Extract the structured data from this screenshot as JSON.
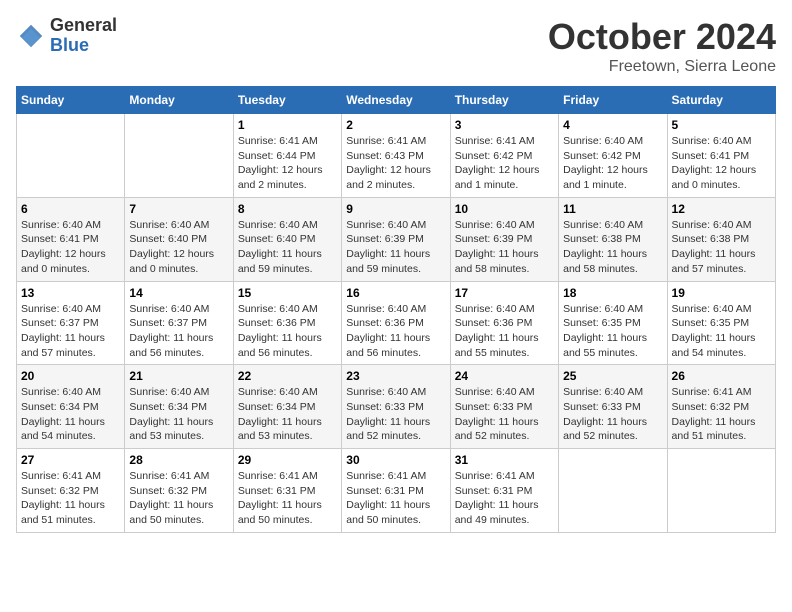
{
  "logo": {
    "general": "General",
    "blue": "Blue"
  },
  "title": "October 2024",
  "location": "Freetown, Sierra Leone",
  "days_header": [
    "Sunday",
    "Monday",
    "Tuesday",
    "Wednesday",
    "Thursday",
    "Friday",
    "Saturday"
  ],
  "weeks": [
    [
      {
        "day": "",
        "detail": ""
      },
      {
        "day": "",
        "detail": ""
      },
      {
        "day": "1",
        "detail": "Sunrise: 6:41 AM\nSunset: 6:44 PM\nDaylight: 12 hours\nand 2 minutes."
      },
      {
        "day": "2",
        "detail": "Sunrise: 6:41 AM\nSunset: 6:43 PM\nDaylight: 12 hours\nand 2 minutes."
      },
      {
        "day": "3",
        "detail": "Sunrise: 6:41 AM\nSunset: 6:42 PM\nDaylight: 12 hours\nand 1 minute."
      },
      {
        "day": "4",
        "detail": "Sunrise: 6:40 AM\nSunset: 6:42 PM\nDaylight: 12 hours\nand 1 minute."
      },
      {
        "day": "5",
        "detail": "Sunrise: 6:40 AM\nSunset: 6:41 PM\nDaylight: 12 hours\nand 0 minutes."
      }
    ],
    [
      {
        "day": "6",
        "detail": "Sunrise: 6:40 AM\nSunset: 6:41 PM\nDaylight: 12 hours\nand 0 minutes."
      },
      {
        "day": "7",
        "detail": "Sunrise: 6:40 AM\nSunset: 6:40 PM\nDaylight: 12 hours\nand 0 minutes."
      },
      {
        "day": "8",
        "detail": "Sunrise: 6:40 AM\nSunset: 6:40 PM\nDaylight: 11 hours\nand 59 minutes."
      },
      {
        "day": "9",
        "detail": "Sunrise: 6:40 AM\nSunset: 6:39 PM\nDaylight: 11 hours\nand 59 minutes."
      },
      {
        "day": "10",
        "detail": "Sunrise: 6:40 AM\nSunset: 6:39 PM\nDaylight: 11 hours\nand 58 minutes."
      },
      {
        "day": "11",
        "detail": "Sunrise: 6:40 AM\nSunset: 6:38 PM\nDaylight: 11 hours\nand 58 minutes."
      },
      {
        "day": "12",
        "detail": "Sunrise: 6:40 AM\nSunset: 6:38 PM\nDaylight: 11 hours\nand 57 minutes."
      }
    ],
    [
      {
        "day": "13",
        "detail": "Sunrise: 6:40 AM\nSunset: 6:37 PM\nDaylight: 11 hours\nand 57 minutes."
      },
      {
        "day": "14",
        "detail": "Sunrise: 6:40 AM\nSunset: 6:37 PM\nDaylight: 11 hours\nand 56 minutes."
      },
      {
        "day": "15",
        "detail": "Sunrise: 6:40 AM\nSunset: 6:36 PM\nDaylight: 11 hours\nand 56 minutes."
      },
      {
        "day": "16",
        "detail": "Sunrise: 6:40 AM\nSunset: 6:36 PM\nDaylight: 11 hours\nand 56 minutes."
      },
      {
        "day": "17",
        "detail": "Sunrise: 6:40 AM\nSunset: 6:36 PM\nDaylight: 11 hours\nand 55 minutes."
      },
      {
        "day": "18",
        "detail": "Sunrise: 6:40 AM\nSunset: 6:35 PM\nDaylight: 11 hours\nand 55 minutes."
      },
      {
        "day": "19",
        "detail": "Sunrise: 6:40 AM\nSunset: 6:35 PM\nDaylight: 11 hours\nand 54 minutes."
      }
    ],
    [
      {
        "day": "20",
        "detail": "Sunrise: 6:40 AM\nSunset: 6:34 PM\nDaylight: 11 hours\nand 54 minutes."
      },
      {
        "day": "21",
        "detail": "Sunrise: 6:40 AM\nSunset: 6:34 PM\nDaylight: 11 hours\nand 53 minutes."
      },
      {
        "day": "22",
        "detail": "Sunrise: 6:40 AM\nSunset: 6:34 PM\nDaylight: 11 hours\nand 53 minutes."
      },
      {
        "day": "23",
        "detail": "Sunrise: 6:40 AM\nSunset: 6:33 PM\nDaylight: 11 hours\nand 52 minutes."
      },
      {
        "day": "24",
        "detail": "Sunrise: 6:40 AM\nSunset: 6:33 PM\nDaylight: 11 hours\nand 52 minutes."
      },
      {
        "day": "25",
        "detail": "Sunrise: 6:40 AM\nSunset: 6:33 PM\nDaylight: 11 hours\nand 52 minutes."
      },
      {
        "day": "26",
        "detail": "Sunrise: 6:41 AM\nSunset: 6:32 PM\nDaylight: 11 hours\nand 51 minutes."
      }
    ],
    [
      {
        "day": "27",
        "detail": "Sunrise: 6:41 AM\nSunset: 6:32 PM\nDaylight: 11 hours\nand 51 minutes."
      },
      {
        "day": "28",
        "detail": "Sunrise: 6:41 AM\nSunset: 6:32 PM\nDaylight: 11 hours\nand 50 minutes."
      },
      {
        "day": "29",
        "detail": "Sunrise: 6:41 AM\nSunset: 6:31 PM\nDaylight: 11 hours\nand 50 minutes."
      },
      {
        "day": "30",
        "detail": "Sunrise: 6:41 AM\nSunset: 6:31 PM\nDaylight: 11 hours\nand 50 minutes."
      },
      {
        "day": "31",
        "detail": "Sunrise: 6:41 AM\nSunset: 6:31 PM\nDaylight: 11 hours\nand 49 minutes."
      },
      {
        "day": "",
        "detail": ""
      },
      {
        "day": "",
        "detail": ""
      }
    ]
  ]
}
